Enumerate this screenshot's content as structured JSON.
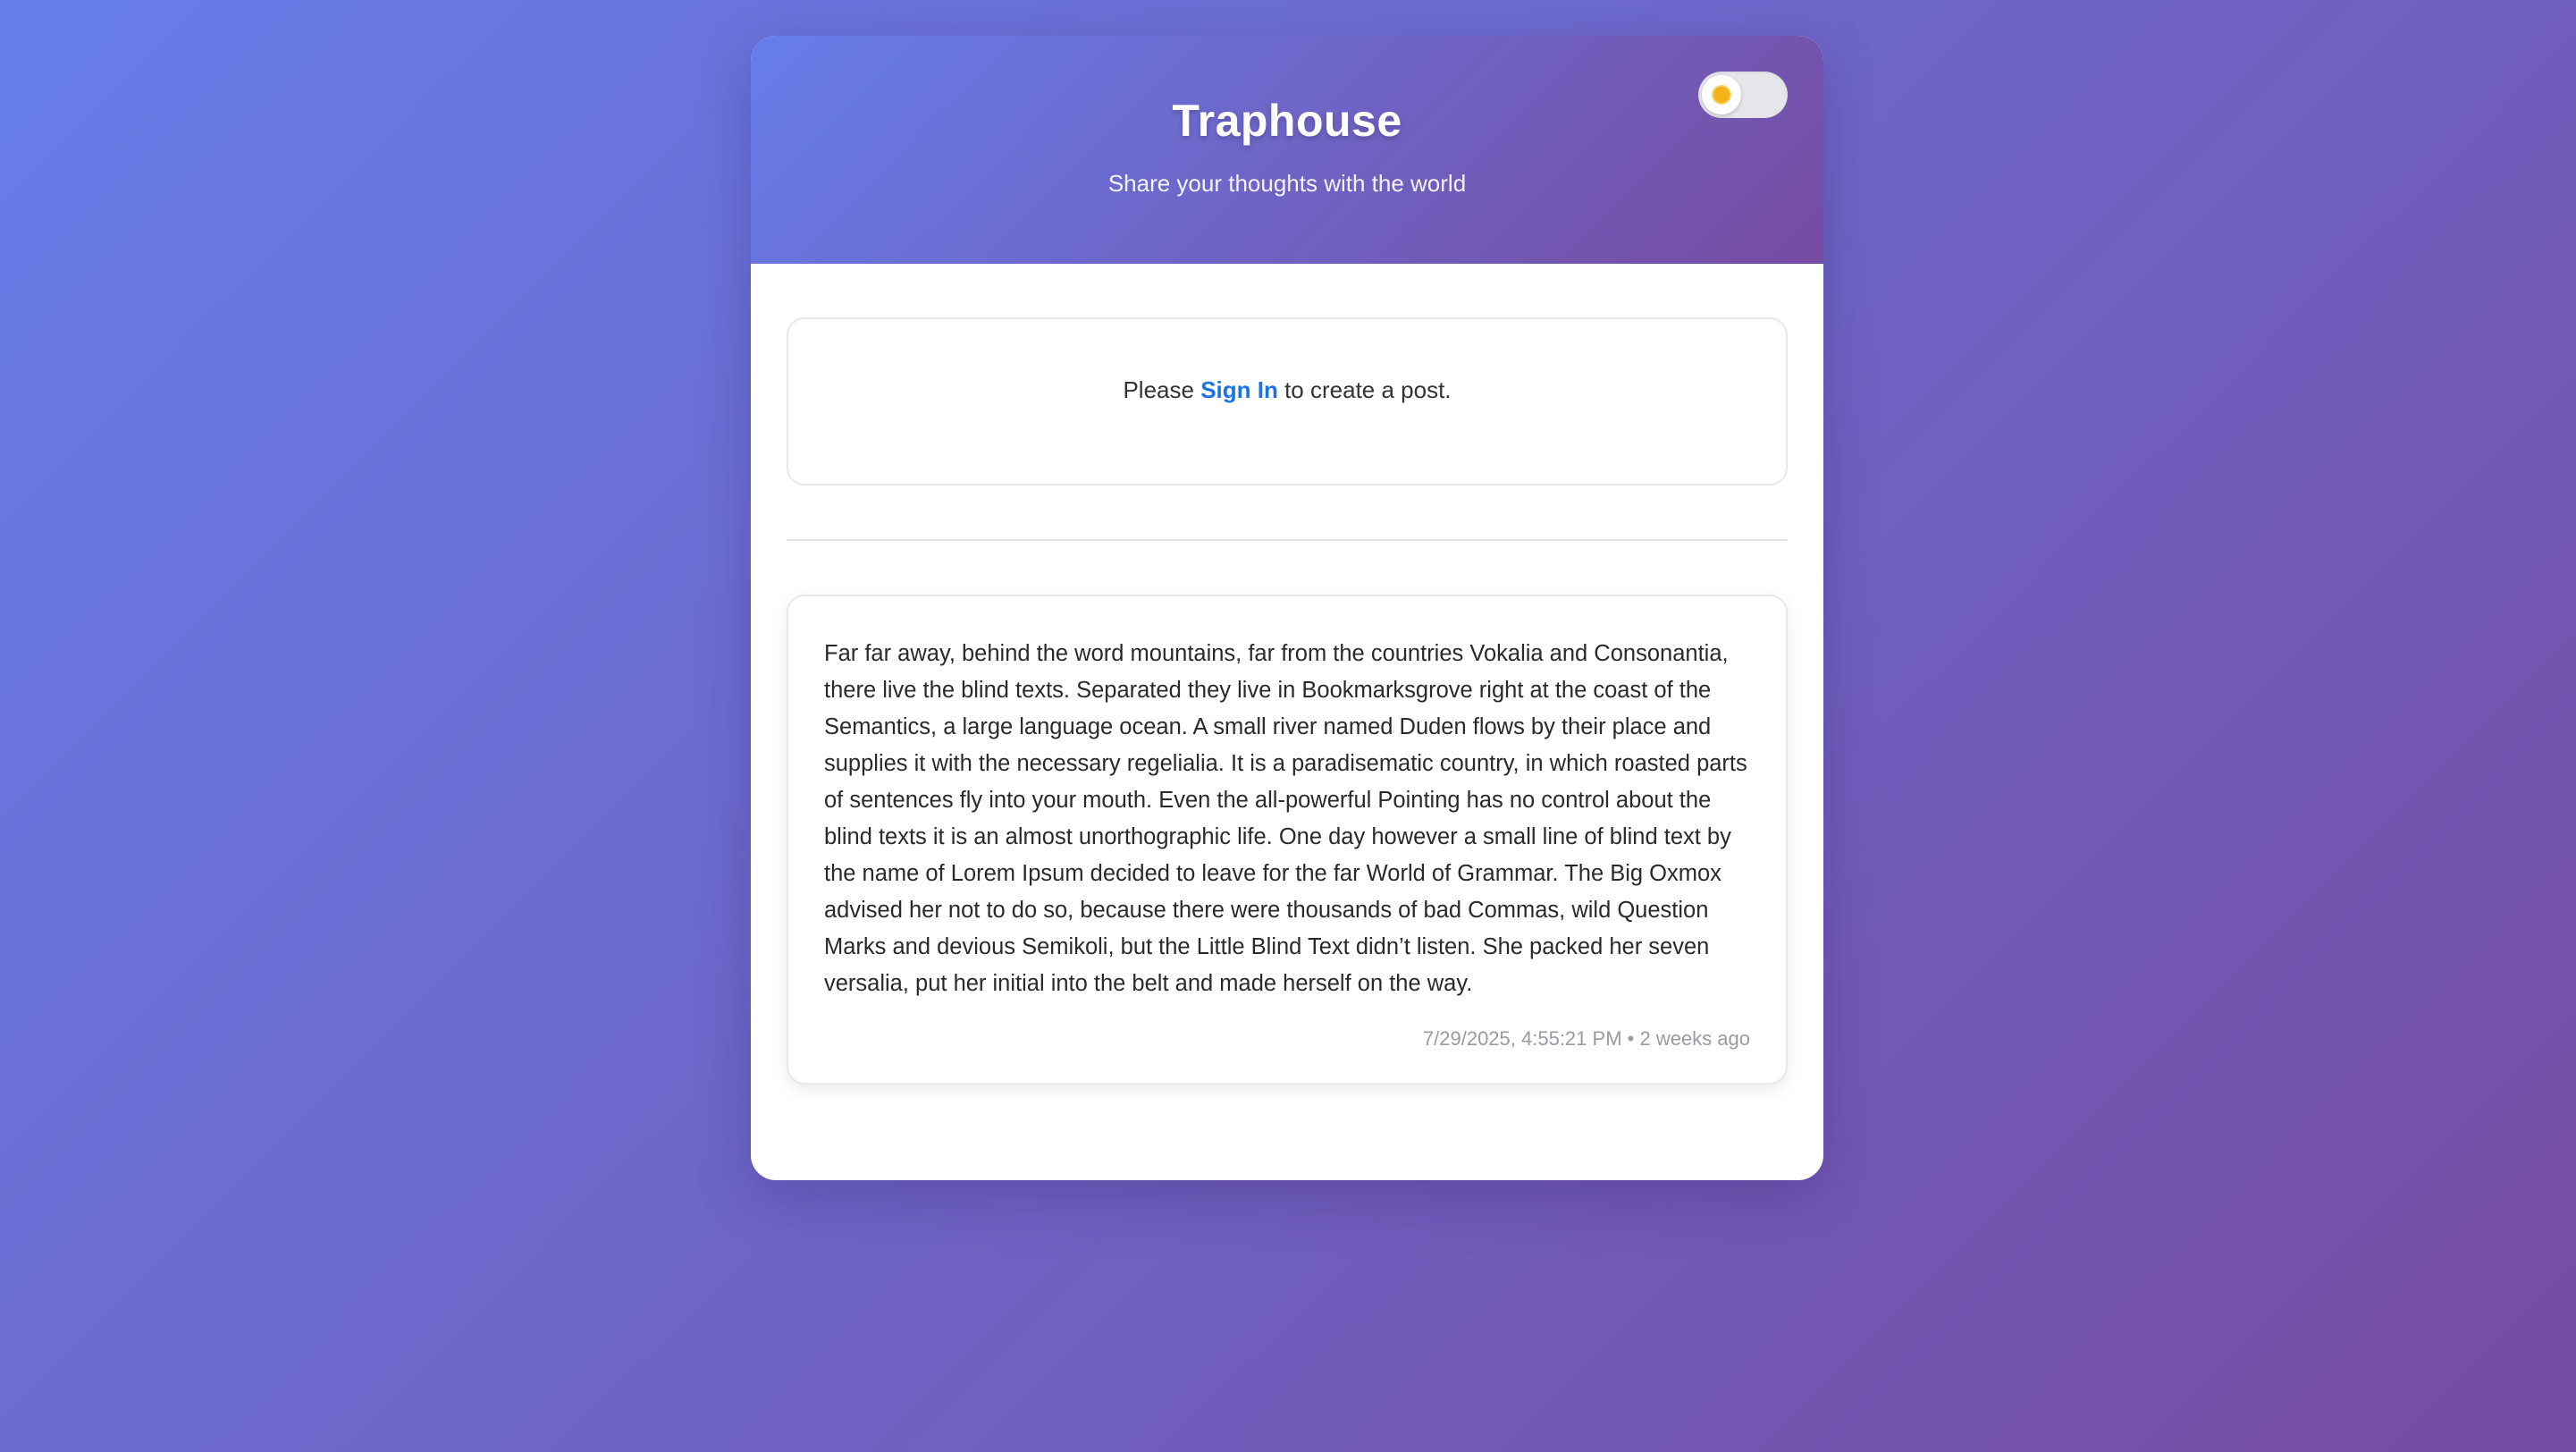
{
  "header": {
    "title": "Traphouse",
    "subtitle": "Share your thoughts with the world",
    "theme_toggle": {
      "state": "light",
      "icon": "sun-icon"
    }
  },
  "signin_prompt": {
    "prefix": "Please ",
    "link_label": "Sign In",
    "suffix": " to create a post."
  },
  "posts": [
    {
      "body": "Far far away, behind the word mountains, far from the countries Vokalia and Consonantia, there live the blind texts. Separated they live in Bookmarksgrove right at the coast of the Semantics, a large language ocean. A small river named Duden flows by their place and supplies it with the necessary regelialia. It is a paradisematic country, in which roasted parts of sentences fly into your mouth. Even the all-powerful Pointing has no control about the blind texts it is an almost unorthographic life. One day however a small line of blind text by the name of Lorem Ipsum decided to leave for the far World of Grammar. The Big Oxmox advised her not to do so, because there were thousands of bad Commas, wild Question Marks and devious Semikoli, but the Little Blind Text didn’t listen. She packed her seven versalia, put her initial into the belt and made herself on the way.",
      "timestamp": "7/29/2025, 4:55:21 PM",
      "separator": " • ",
      "relative_time": "2 weeks ago"
    }
  ],
  "colors": {
    "gradient_start": "#667eea",
    "gradient_end": "#764ba2",
    "link": "#1a73e8",
    "sun": "#f2b418"
  }
}
